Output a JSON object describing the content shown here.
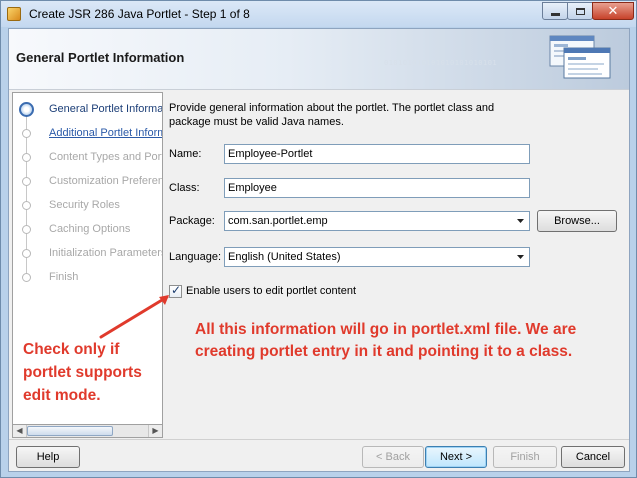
{
  "window": {
    "title": "Create JSR 286 Java Portlet - Step 1 of 8",
    "controls": {
      "minimize": "–",
      "maximize": "□",
      "close": "✕"
    }
  },
  "header": {
    "title": "General Portlet Information",
    "binary": "010101010101010101010101"
  },
  "steps": [
    {
      "label": "General Portlet Information",
      "state": "current"
    },
    {
      "label": "Additional Portlet Information",
      "state": "link"
    },
    {
      "label": "Content Types and Portlet Modes",
      "state": "disabled"
    },
    {
      "label": "Customization Preferences",
      "state": "disabled"
    },
    {
      "label": "Security Roles",
      "state": "disabled"
    },
    {
      "label": "Caching Options",
      "state": "disabled"
    },
    {
      "label": "Initialization Parameters",
      "state": "disabled"
    },
    {
      "label": "Finish",
      "state": "disabled"
    }
  ],
  "form": {
    "description": "Provide general information about the portlet. The portlet class and package must be valid Java names.",
    "name_label": "Name:",
    "name_value": "Employee-Portlet",
    "class_label": "Class:",
    "class_value": "Employee",
    "package_label": "Package:",
    "package_value": "com.san.portlet.emp",
    "browse_button": "Browse...",
    "language_label": "Language:",
    "language_value": "English (United States)",
    "edit_checkbox_label": "Enable users to edit portlet content",
    "edit_checkbox_checked": true
  },
  "annotations": {
    "right": "All this information will go in portlet.xml file. We are creating portlet entry in it and pointing it to a class.",
    "left": "Check only if portlet supports edit mode.",
    "color": "#e03a2c"
  },
  "footer": {
    "help": "Help",
    "back": "< Back",
    "next": "Next >",
    "finish": "Finish",
    "cancel": "Cancel"
  }
}
